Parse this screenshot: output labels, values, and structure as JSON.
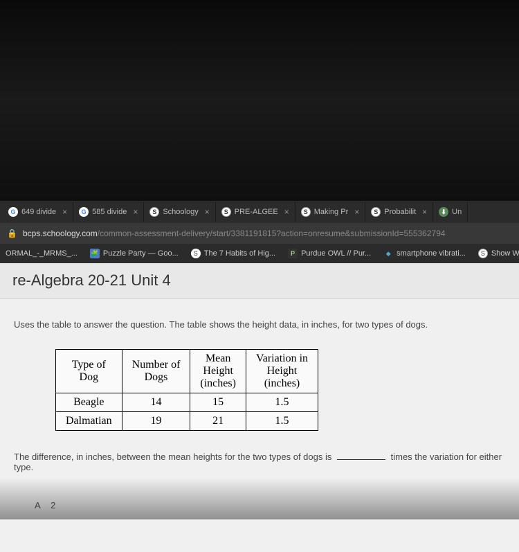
{
  "tabs": [
    {
      "icon": "G",
      "label": "649 divide"
    },
    {
      "icon": "G",
      "label": "585 divide"
    },
    {
      "icon": "S",
      "label": "Schoology"
    },
    {
      "icon": "S",
      "label": "PRE-ALGEE"
    },
    {
      "icon": "S",
      "label": "Making Pr"
    },
    {
      "icon": "S",
      "label": "Probabilit"
    },
    {
      "icon": "U",
      "label": "Un"
    }
  ],
  "url": {
    "lock": "🔒",
    "domain": "bcps.schoology.com",
    "path": "/common-assessment-delivery/start/3381191815?action=onresume&submissionId=555362794"
  },
  "bookmarks": [
    {
      "label": "ORMAL_-_MRMS_..."
    },
    {
      "label": "Puzzle Party — Goo..."
    },
    {
      "label": "The 7 Habits of Hig..."
    },
    {
      "label": "Purdue OWL // Pur..."
    },
    {
      "label": "smartphone vibrati..."
    },
    {
      "label": "Show Wha"
    }
  ],
  "header": {
    "title": "re-Algebra 20-21 Unit 4"
  },
  "question": {
    "prompt": "Uses the table to answer the question. The table shows the height data, in inches, for two types of dogs.",
    "fill_blank_pre": "The difference, in inches, between the mean heights for the two types of dogs is",
    "fill_blank_post": "times the variation for either type."
  },
  "chart_data": {
    "type": "table",
    "headers": [
      "Type of Dog",
      "Number of Dogs",
      "Mean Height (inches)",
      "Variation in Height (inches)"
    ],
    "rows": [
      {
        "type": "Beagle",
        "number": "14",
        "mean": "15",
        "variation": "1.5"
      },
      {
        "type": "Dalmatian",
        "number": "19",
        "mean": "21",
        "variation": "1.5"
      }
    ]
  },
  "answer_label": "A",
  "answer_hint": "2"
}
